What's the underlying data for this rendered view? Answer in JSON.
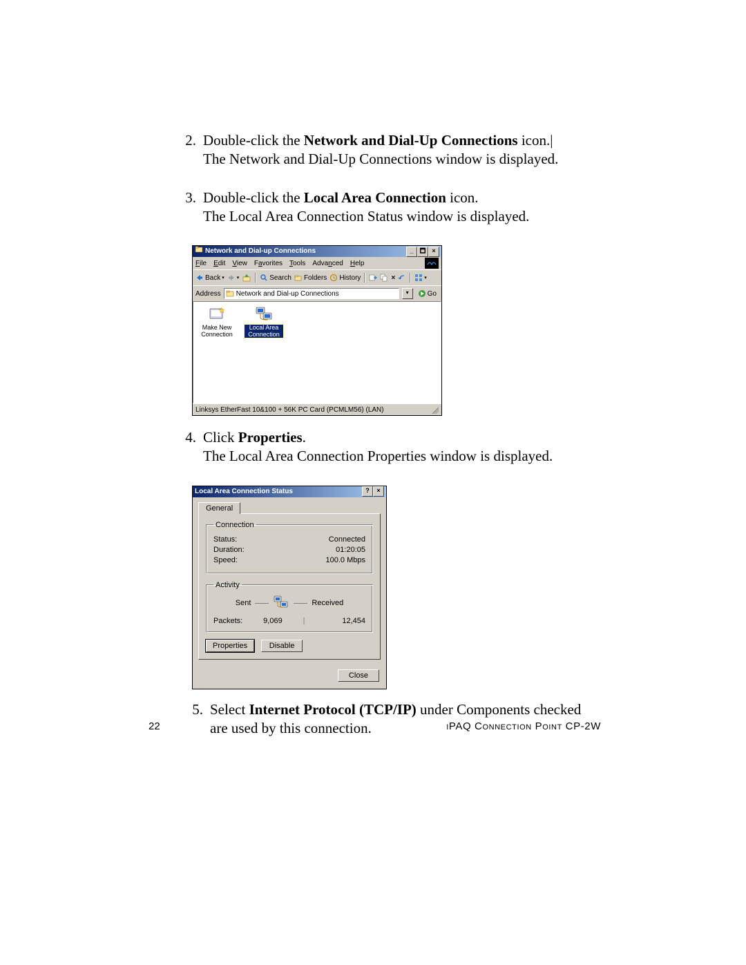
{
  "steps": {
    "s2": {
      "num": "2.",
      "prefix": "Double-click the ",
      "bold": "Network and Dial-Up Connections",
      "suffix": " icon.|",
      "line2": "The Network and Dial-Up Connections window is displayed."
    },
    "s3": {
      "num": "3.",
      "prefix": "Double-click the ",
      "bold": "Local Area Connection",
      "suffix": " icon.",
      "line2": "The Local Area Connection Status window is displayed."
    },
    "s4": {
      "num": "4.",
      "prefix": "Click ",
      "bold": "Properties",
      "suffix": ".",
      "line2": "The Local Area Connection Properties window is displayed."
    },
    "s5": {
      "num": "5.",
      "prefix": "Select ",
      "bold": "Internet Protocol (TCP/IP)",
      "suffix": " under Components checked are used by this connection."
    }
  },
  "win1": {
    "title": "Network and Dial-up Connections",
    "menu": {
      "file": "File",
      "edit": "Edit",
      "view": "View",
      "favorites": "Favorites",
      "tools": "Tools",
      "advanced": "Advanced",
      "help": "Help"
    },
    "toolbar": {
      "back": "Back",
      "search": "Search",
      "folders": "Folders",
      "history": "History"
    },
    "address_label": "Address",
    "address_value": "Network and Dial-up Connections",
    "go_label": "Go",
    "icons": {
      "make_new": "Make New Connection",
      "lac": "Local Area Connection"
    },
    "status_text": "Linksys EtherFast 10&100 + 56K PC Card (PCMLM56) (LAN)"
  },
  "win2": {
    "title": "Local Area Connection Status",
    "tab": "General",
    "group_connection": "Connection",
    "status_label": "Status:",
    "status_value": "Connected",
    "duration_label": "Duration:",
    "duration_value": "01:20:05",
    "speed_label": "Speed:",
    "speed_value": "100.0 Mbps",
    "group_activity": "Activity",
    "sent_label": "Sent",
    "received_label": "Received",
    "packets_label": "Packets:",
    "packets_sent": "9,069",
    "packets_received": "12,454",
    "btn_properties": "Properties",
    "btn_disable": "Disable",
    "btn_close": "Close"
  },
  "footer": {
    "page": "22",
    "product": "iPAQ Connection Point CP-2W"
  },
  "colors": {
    "titlebar_dark": "#0a246a",
    "titlebar_light": "#a6caf0",
    "face": "#d4d0c8",
    "shadow": "#808080"
  }
}
